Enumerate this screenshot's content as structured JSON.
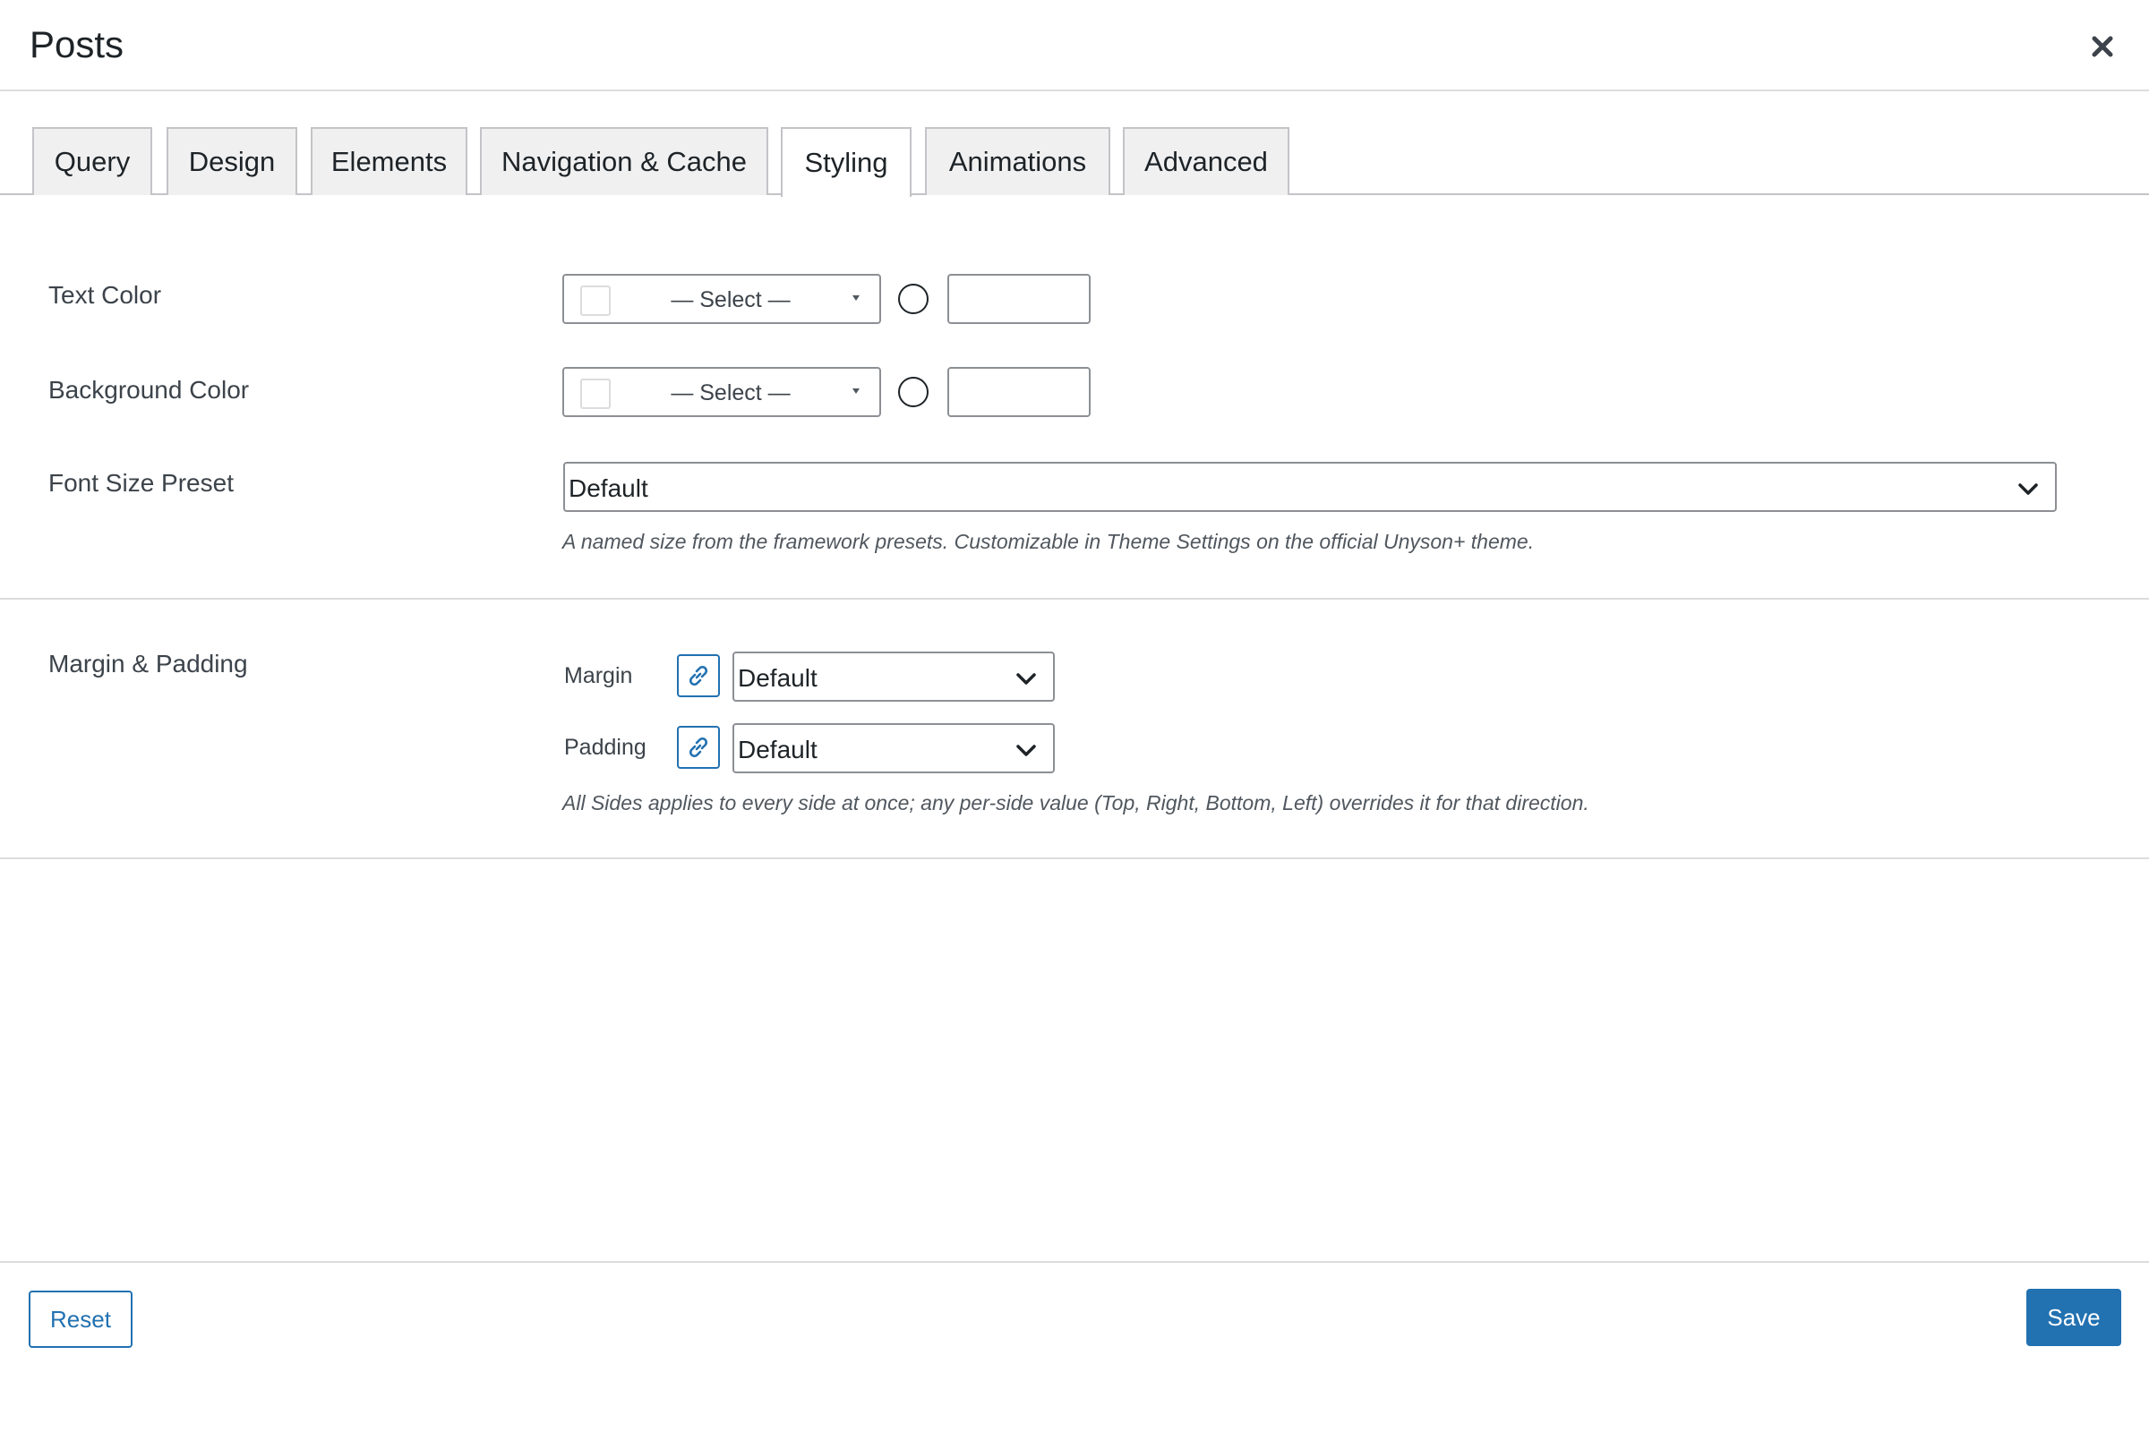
{
  "modal": {
    "title": "Posts",
    "close_icon": "close-icon"
  },
  "tabs": [
    {
      "label": "Query",
      "active": false
    },
    {
      "label": "Design",
      "active": false
    },
    {
      "label": "Elements",
      "active": false
    },
    {
      "label": "Navigation & Cache",
      "active": false
    },
    {
      "label": "Styling",
      "active": true
    },
    {
      "label": "Animations",
      "active": false
    },
    {
      "label": "Advanced",
      "active": false
    }
  ],
  "styling": {
    "text_color": {
      "label": "Text Color",
      "select_text": "— Select —",
      "custom_value": ""
    },
    "background_color": {
      "label": "Background Color",
      "select_text": "— Select —",
      "custom_value": ""
    },
    "font_size_preset": {
      "label": "Font Size Preset",
      "value": "Default",
      "description": "A named size from the framework presets. Customizable in Theme Settings on the official Unyson+ theme."
    },
    "margin_padding": {
      "label": "Margin & Padding",
      "margin_label": "Margin",
      "margin_value": "Default",
      "padding_label": "Padding",
      "padding_value": "Default",
      "description": "All Sides applies to every side at once; any per-side value (Top, Right, Bottom, Left) overrides it for that direction."
    }
  },
  "footer": {
    "reset_label": "Reset",
    "save_label": "Save"
  },
  "colors": {
    "accent": "#2271b1",
    "border": "#8c8f94",
    "tab_bg": "#f0f0f1"
  }
}
